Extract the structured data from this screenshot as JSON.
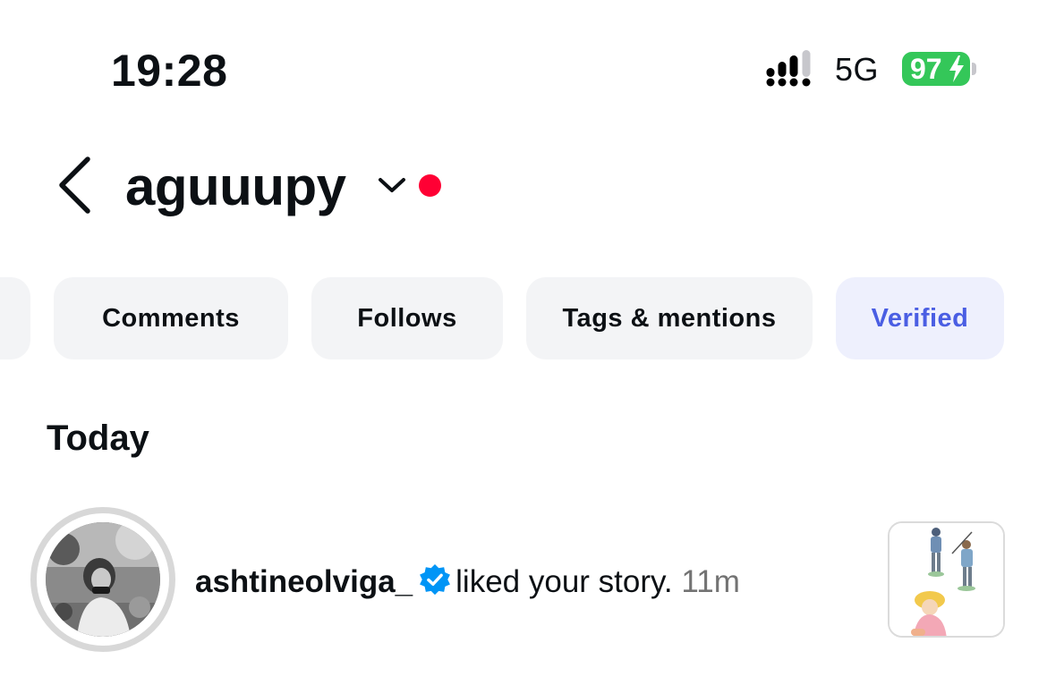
{
  "status_bar": {
    "time": "19:28",
    "network": "5G",
    "battery": "97",
    "icons": [
      "signal-icon",
      "charging-bolt-icon"
    ]
  },
  "header": {
    "account_name": "aguuupy",
    "icons": [
      "back-arrow-icon",
      "chevron-down-icon"
    ],
    "notification_dot_color": "#ff0034"
  },
  "filters": {
    "chips": [
      {
        "label": "Comments"
      },
      {
        "label": "Follows"
      },
      {
        "label": "Tags & mentions"
      },
      {
        "label": "Verified",
        "selected": true
      }
    ],
    "selected_color": "#4a5ee3"
  },
  "section": {
    "title": "Today"
  },
  "notifications": [
    {
      "username": "ashtineolviga_",
      "verified": true,
      "action": "liked your story.",
      "time": "11m"
    }
  ],
  "colors": {
    "verified_badge": "#0095f6",
    "battery": "#34c759",
    "chip_bg": "#f3f4f6"
  }
}
